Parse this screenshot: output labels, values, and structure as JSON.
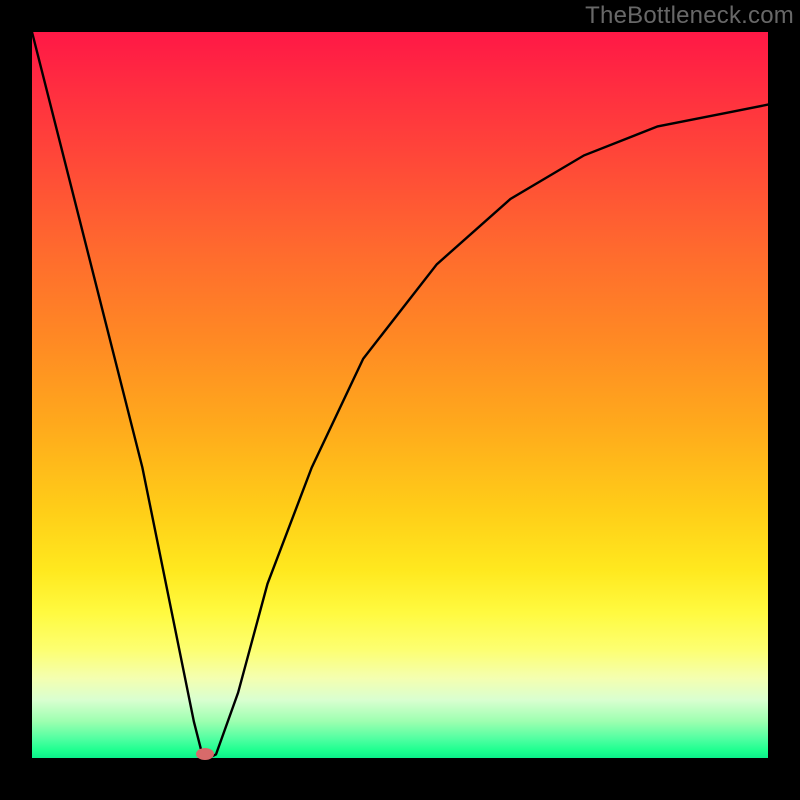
{
  "watermark": "TheBottleneck.com",
  "chart_data": {
    "type": "line",
    "title": "",
    "xlabel": "",
    "ylabel": "",
    "xlim": [
      0,
      100
    ],
    "ylim": [
      0,
      100
    ],
    "series": [
      {
        "name": "curve",
        "x": [
          0,
          5,
          10,
          15,
          20,
          22,
          23,
          24,
          25,
          28,
          32,
          38,
          45,
          55,
          65,
          75,
          85,
          95,
          100
        ],
        "y": [
          100,
          80,
          60,
          40,
          15,
          5,
          1,
          0,
          0.5,
          9,
          24,
          40,
          55,
          68,
          77,
          83,
          87,
          89,
          90
        ]
      }
    ],
    "marker": {
      "x": 23.5,
      "y": 0.5
    },
    "gradient_colors": {
      "top": "#ff1846",
      "mid": "#ffce18",
      "bottom": "#0bf08a"
    }
  }
}
